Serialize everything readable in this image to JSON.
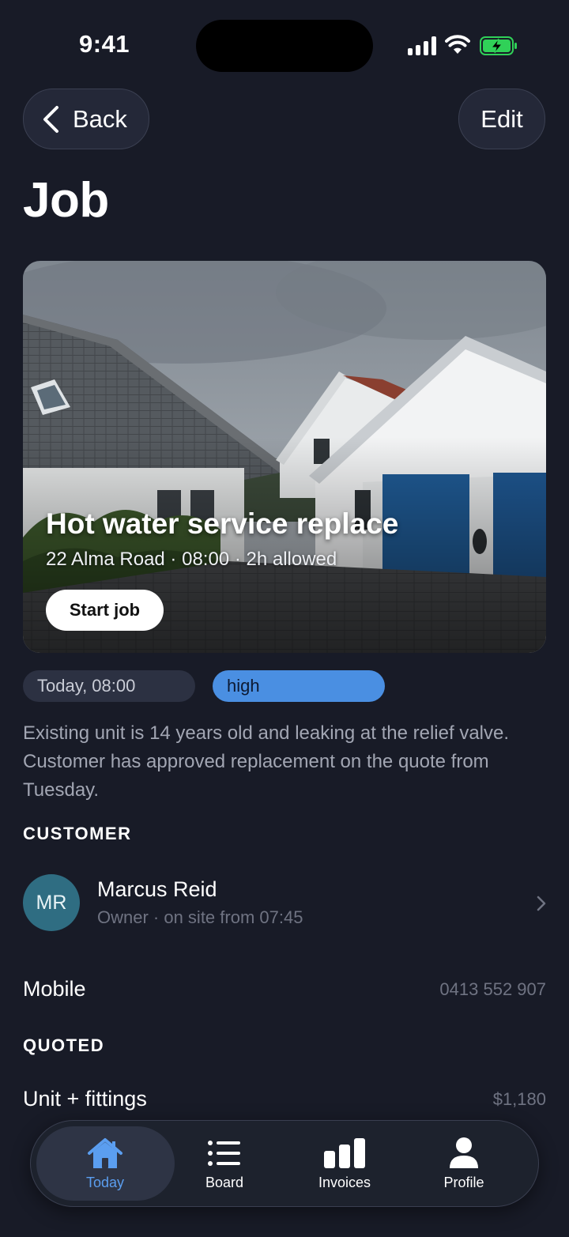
{
  "status_bar": {
    "time": "9:41"
  },
  "nav": {
    "back_label": "Back",
    "edit_label": "Edit"
  },
  "page": {
    "title": "Job"
  },
  "hero": {
    "title": "Hot water service replace",
    "subtitle": "22 Alma Road · 08:00 · 2h allowed",
    "start_label": "Start job"
  },
  "chips": {
    "date": "Today, 08:00",
    "priority": "high"
  },
  "description": "Existing unit is 14 years old and leaking at the relief valve. Customer has approved replacement on the quote from Tuesday.",
  "customer": {
    "section_label": "CUSTOMER",
    "initials": "MR",
    "name": "Marcus Reid",
    "subtitle": "Owner · on site from 07:45"
  },
  "contact": {
    "label": "Mobile",
    "value": "0413 552 907"
  },
  "quoted": {
    "section_label": "QUOTED",
    "items": [
      {
        "label": "Unit + fittings",
        "value": "$1,180"
      }
    ]
  },
  "tabs": [
    {
      "label": "Today",
      "icon": "house-icon",
      "active": true
    },
    {
      "label": "Board",
      "icon": "list-icon",
      "active": false
    },
    {
      "label": "Invoices",
      "icon": "bar-chart-icon",
      "active": false
    },
    {
      "label": "Profile",
      "icon": "person-icon",
      "active": false
    }
  ],
  "colors": {
    "background": "#181b27",
    "accent": "#5b9ef0",
    "priority_chip": "#4a8fe2",
    "battery": "#30d158"
  }
}
